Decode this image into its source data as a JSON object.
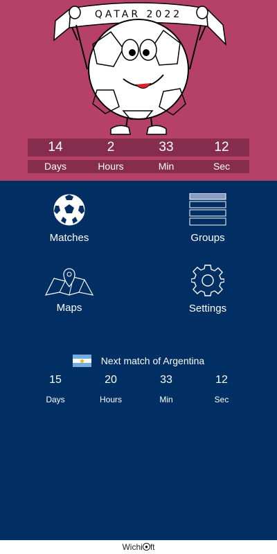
{
  "header": {
    "banner_text": "QATAR 2022",
    "countdown": {
      "values": [
        "14",
        "2",
        "33",
        "12"
      ],
      "labels": [
        "Days",
        "Hours",
        "Min",
        "Sec"
      ]
    }
  },
  "menu": {
    "matches": {
      "label": "Matches",
      "icon": "soccer-ball-icon"
    },
    "groups": {
      "label": "Groups",
      "icon": "groups-list-icon"
    },
    "maps": {
      "label": "Maps",
      "icon": "map-pin-icon"
    },
    "settings": {
      "label": "Settings",
      "icon": "gear-icon"
    }
  },
  "next_match": {
    "title": "Next match of Argentina",
    "flag_icon": "argentina-flag-icon",
    "countdown": {
      "values": [
        "15",
        "20",
        "33",
        "12"
      ],
      "labels": [
        "Days",
        "Hours",
        "Min",
        "Sec"
      ]
    }
  },
  "footer": {
    "brand_prefix": "Wichi",
    "brand_suffix": "ft",
    "brand_icon": "soccer-ball-icon"
  },
  "colors": {
    "header_bg": "#b54168",
    "countdown_bg": "#862c4c",
    "main_bg": "#022f63",
    "text": "#ffffff"
  }
}
